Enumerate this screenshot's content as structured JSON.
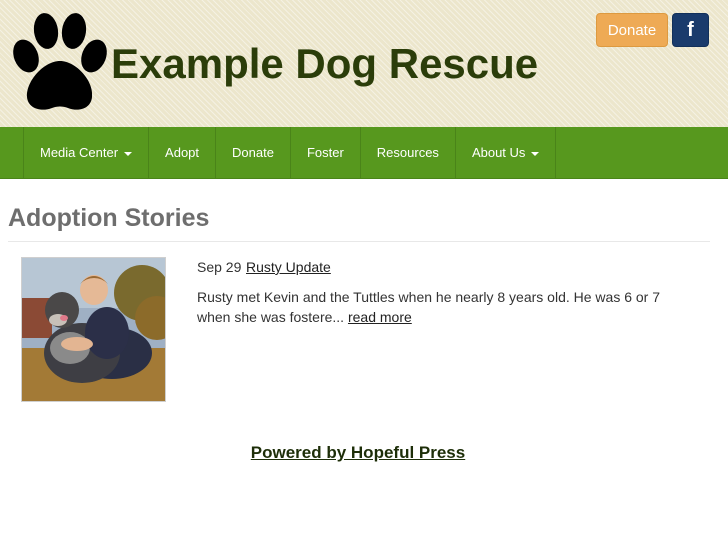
{
  "header": {
    "site_title": "Example Dog Rescue",
    "donate_label": "Donate",
    "facebook_label": "f"
  },
  "nav": {
    "items": [
      {
        "label": "Media Center",
        "has_dropdown": true
      },
      {
        "label": "Adopt",
        "has_dropdown": false
      },
      {
        "label": "Donate",
        "has_dropdown": false
      },
      {
        "label": "Foster",
        "has_dropdown": false
      },
      {
        "label": "Resources",
        "has_dropdown": false
      },
      {
        "label": "About Us",
        "has_dropdown": true
      }
    ]
  },
  "main": {
    "heading": "Adoption Stories",
    "stories": [
      {
        "date": "Sep 29",
        "title": "Rusty Update",
        "excerpt": "Rusty met Kevin and the Tuttles when he nearly 8 years old. He was 6 or 7 when she was fostere...",
        "read_more": "read more"
      }
    ]
  },
  "footer": {
    "powered_by": "Powered by Hopeful Press"
  },
  "colors": {
    "header_bg": "#ece6cc",
    "nav_bg": "#57981e",
    "title_color": "#2b3d0a",
    "donate_button": "#eeaa55",
    "facebook_button": "#1a3b6c"
  },
  "icons": {
    "logo": "paw-print-icon",
    "social": "facebook-icon",
    "dropdown": "caret-down-icon"
  }
}
